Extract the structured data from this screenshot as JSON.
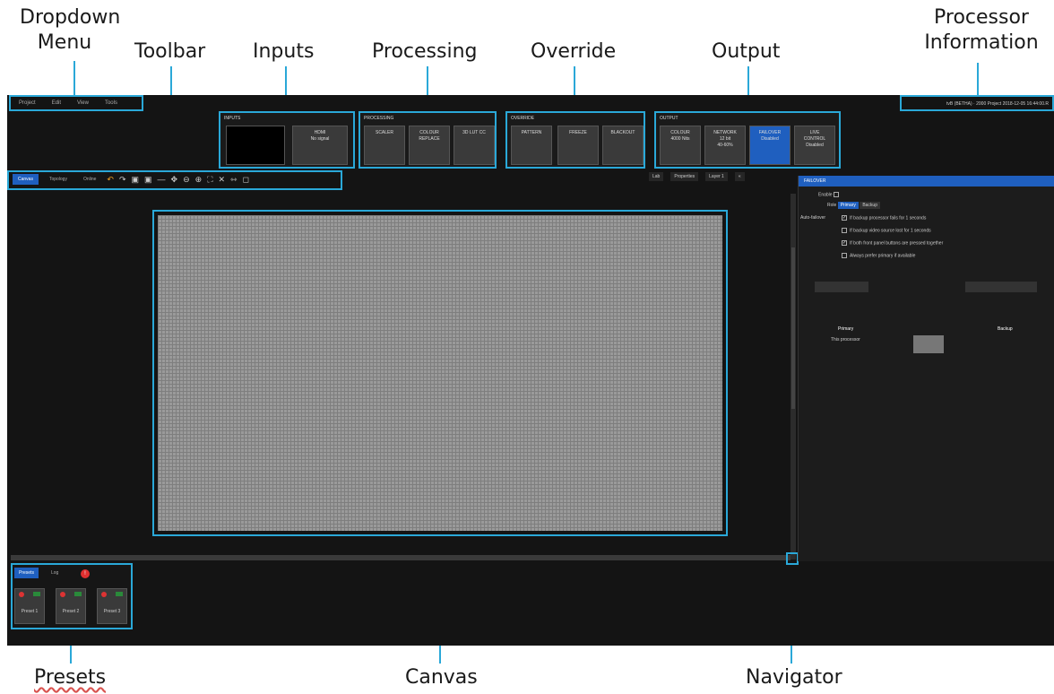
{
  "callouts": {
    "dropdown": "Dropdown\nMenu",
    "toolbar": "Toolbar",
    "inputs": "Inputs",
    "processing": "Processing",
    "override": "Override",
    "output": "Output",
    "processor_info": "Processor\nInformation",
    "presets": "Presets",
    "canvas": "Canvas",
    "navigator": "Navigator"
  },
  "menu": [
    "Project",
    "Edit",
    "View",
    "Tools"
  ],
  "processor_info": "tvB (BETHA) · 2000 Project 2018-12-05 16:44:00.R",
  "groups": {
    "inputs": {
      "title": "INPUTS",
      "tiles": [
        "",
        "HDMI\nNo signal"
      ]
    },
    "processing": {
      "title": "PROCESSING",
      "tiles": [
        "SCALER",
        "COLOUR\nREPLACE",
        "3D LUT CC"
      ]
    },
    "override": {
      "title": "OVERRIDE",
      "tiles": [
        "PATTERN",
        "FREEZE",
        "BLACKOUT"
      ]
    },
    "output": {
      "title": "OUTPUT",
      "tiles": [
        "COLOUR\n4000 Nits",
        "NETWORK\n12 bit\n40-60%",
        "FAILOVER\nDisabled",
        "LIVE\nCONTROL\nDisabled"
      ]
    }
  },
  "toolbar": {
    "tabs": [
      "Canvas",
      "Topology",
      "Online"
    ]
  },
  "right_bar": [
    "Lab",
    "Properties",
    "Layer 1"
  ],
  "panel": {
    "title": "FAILOVER",
    "enable": "Enable",
    "role_label": "Role",
    "role_primary": "Primary",
    "role_backup": "Backup",
    "auto_failover": "Auto-failover",
    "opt1": "If backup processor fails for 1 seconds",
    "opt2": "If backup video source lost for 1 seconds",
    "opt3": "If both front panel buttons are pressed together",
    "opt4": "Always prefer primary if available",
    "primary_col": "Primary",
    "backup_col": "Backup",
    "this_processor": "This processor"
  },
  "presets": {
    "tabs": [
      "Presets",
      "Log"
    ],
    "badge": "!",
    "items": [
      "Preset 1",
      "Preset 2",
      "Preset 3"
    ]
  }
}
